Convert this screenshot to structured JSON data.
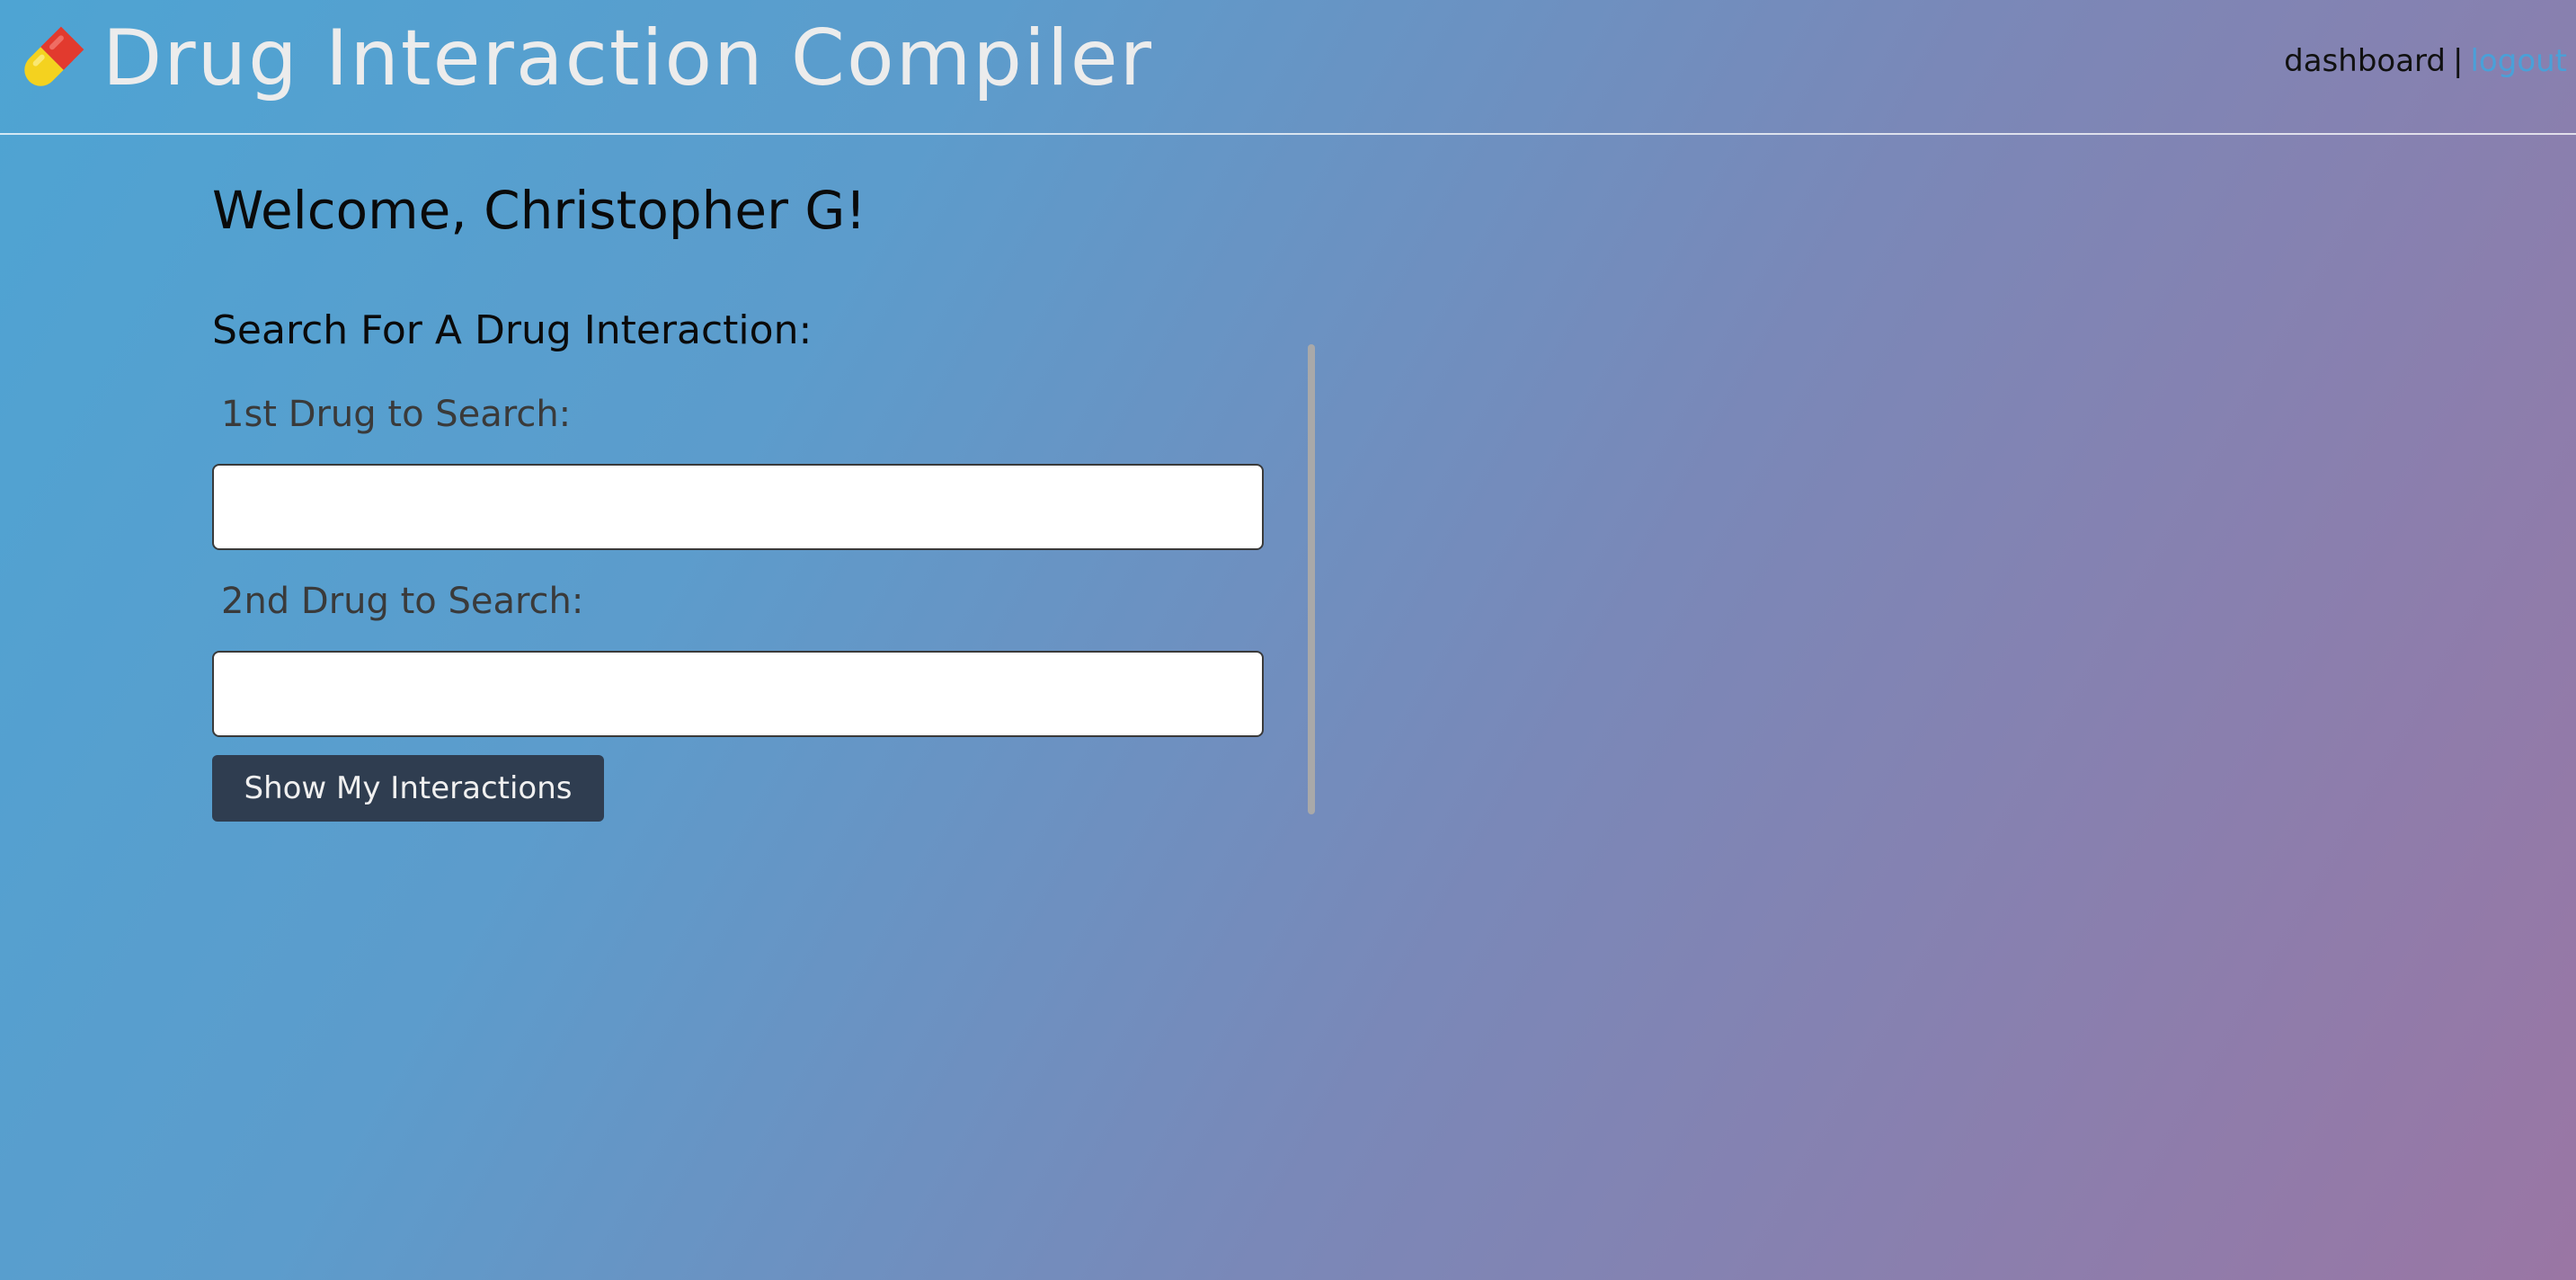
{
  "header": {
    "icon": "pill-icon",
    "title": "Drug Interaction Compiler",
    "nav": {
      "dashboard": "dashboard",
      "separator": "|",
      "logout": "logout"
    }
  },
  "main": {
    "welcome": "Welcome, Christopher G!",
    "search_heading": "Search For A Drug Interaction:",
    "drug1_label": "1st Drug to Search:",
    "drug1_value": "",
    "drug2_label": "2nd Drug to Search:",
    "drug2_value": "",
    "submit_label": "Show My Interactions"
  },
  "colors": {
    "gradient_start": "#4ea4d3",
    "gradient_end": "#9a76a4",
    "button_bg": "#2f3d50",
    "logout_link": "#4aa0d8"
  }
}
